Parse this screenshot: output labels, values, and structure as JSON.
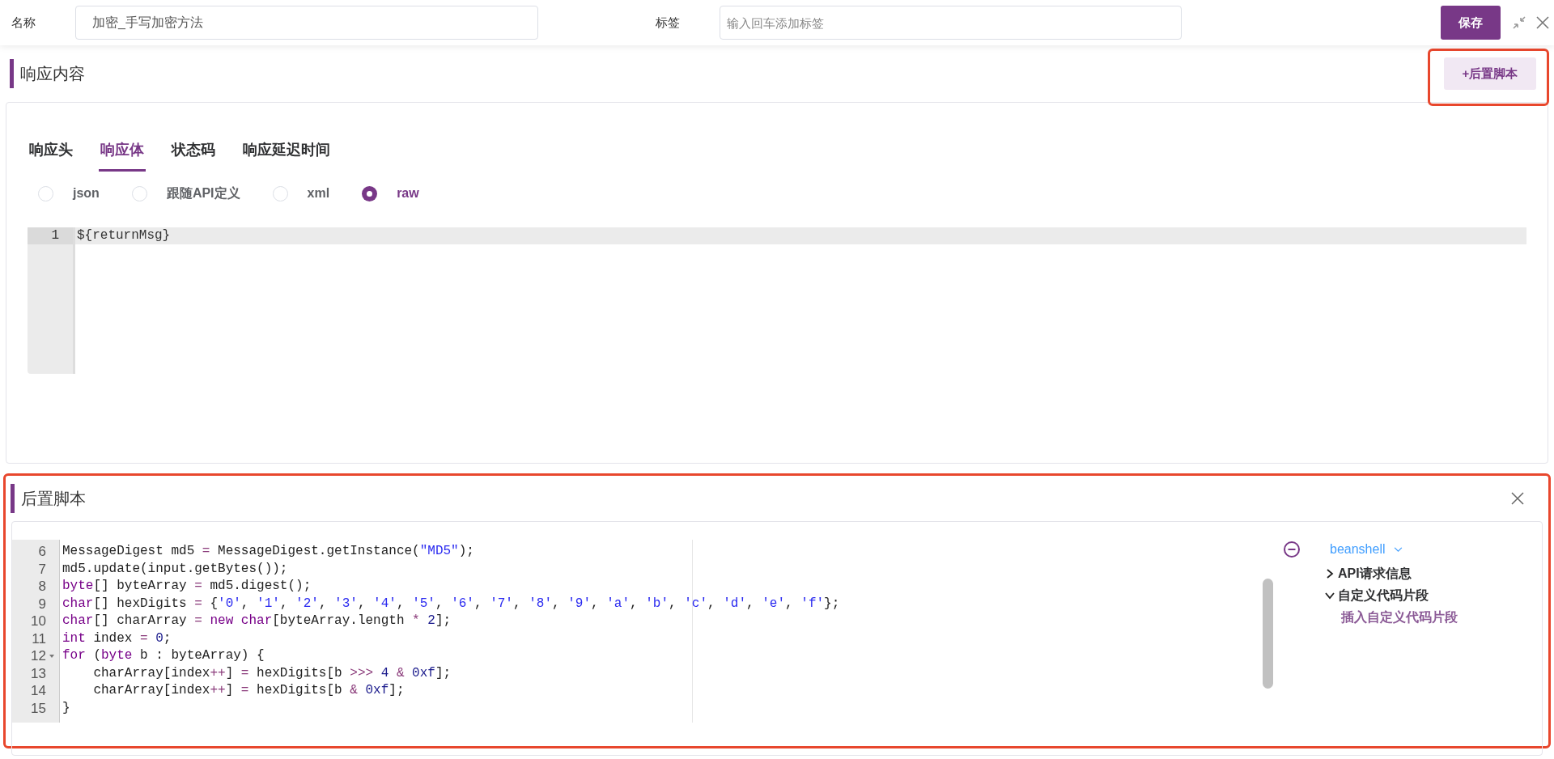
{
  "form": {
    "name_label": "名称",
    "name_value": "加密_手写加密方法",
    "tags_label": "标签",
    "tags_placeholder": "输入回车添加标签",
    "save_button": "保存"
  },
  "response_section": {
    "title": "响应内容",
    "add_script_button": "+后置脚本",
    "tabs": [
      {
        "label": "响应头",
        "selected": false
      },
      {
        "label": "响应体",
        "selected": true
      },
      {
        "label": "状态码",
        "selected": false
      },
      {
        "label": "响应延迟时间",
        "selected": false
      }
    ],
    "formats": [
      {
        "label": "json",
        "selected": false
      },
      {
        "label": "跟随API定义",
        "selected": false
      },
      {
        "label": "xml",
        "selected": false
      },
      {
        "label": "raw",
        "selected": true
      }
    ],
    "editor": {
      "lines": [
        {
          "number": "1",
          "text": "${returnMsg}"
        }
      ]
    }
  },
  "post_script": {
    "title": "后置脚本",
    "language": "beanshell",
    "lines": [
      {
        "number": "6",
        "tokens": [
          {
            "kind": "plain",
            "text": "MessageDigest md5 "
          },
          {
            "kind": "operator",
            "text": "="
          },
          {
            "kind": "plain",
            "text": " MessageDigest.getInstance("
          },
          {
            "kind": "string",
            "text": "\"MD5\""
          },
          {
            "kind": "plain",
            "text": ");"
          }
        ]
      },
      {
        "number": "7",
        "tokens": [
          {
            "kind": "plain",
            "text": "md5.update(input.getBytes());"
          }
        ]
      },
      {
        "number": "8",
        "tokens": [
          {
            "kind": "keyword",
            "text": "byte"
          },
          {
            "kind": "plain",
            "text": "[] byteArray "
          },
          {
            "kind": "operator",
            "text": "="
          },
          {
            "kind": "plain",
            "text": " md5.digest();"
          }
        ]
      },
      {
        "number": "9",
        "tokens": [
          {
            "kind": "keyword",
            "text": "char"
          },
          {
            "kind": "plain",
            "text": "[] hexDigits "
          },
          {
            "kind": "operator",
            "text": "="
          },
          {
            "kind": "plain",
            "text": " {"
          },
          {
            "kind": "string",
            "text": "'0'"
          },
          {
            "kind": "plain",
            "text": ", "
          },
          {
            "kind": "string",
            "text": "'1'"
          },
          {
            "kind": "plain",
            "text": ", "
          },
          {
            "kind": "string",
            "text": "'2'"
          },
          {
            "kind": "plain",
            "text": ", "
          },
          {
            "kind": "string",
            "text": "'3'"
          },
          {
            "kind": "plain",
            "text": ", "
          },
          {
            "kind": "string",
            "text": "'4'"
          },
          {
            "kind": "plain",
            "text": ", "
          },
          {
            "kind": "string",
            "text": "'5'"
          },
          {
            "kind": "plain",
            "text": ", "
          },
          {
            "kind": "string",
            "text": "'6'"
          },
          {
            "kind": "plain",
            "text": ", "
          },
          {
            "kind": "string",
            "text": "'7'"
          },
          {
            "kind": "plain",
            "text": ", "
          },
          {
            "kind": "string",
            "text": "'8'"
          },
          {
            "kind": "plain",
            "text": ", "
          },
          {
            "kind": "string",
            "text": "'9'"
          },
          {
            "kind": "plain",
            "text": ", "
          },
          {
            "kind": "string",
            "text": "'a'"
          },
          {
            "kind": "plain",
            "text": ", "
          },
          {
            "kind": "string",
            "text": "'b'"
          },
          {
            "kind": "plain",
            "text": ", "
          },
          {
            "kind": "string",
            "text": "'c'"
          },
          {
            "kind": "plain",
            "text": ", "
          },
          {
            "kind": "string",
            "text": "'d'"
          },
          {
            "kind": "plain",
            "text": ", "
          },
          {
            "kind": "string",
            "text": "'e'"
          },
          {
            "kind": "plain",
            "text": ", "
          },
          {
            "kind": "string",
            "text": "'f'"
          },
          {
            "kind": "plain",
            "text": "};"
          }
        ]
      },
      {
        "number": "10",
        "tokens": [
          {
            "kind": "keyword",
            "text": "char"
          },
          {
            "kind": "plain",
            "text": "[] charArray "
          },
          {
            "kind": "operator",
            "text": "="
          },
          {
            "kind": "keyword",
            "text": " new"
          },
          {
            "kind": "keyword",
            "text": " char"
          },
          {
            "kind": "plain",
            "text": "[byteArray.length "
          },
          {
            "kind": "operator",
            "text": "*"
          },
          {
            "kind": "number",
            "text": " 2"
          },
          {
            "kind": "plain",
            "text": "];"
          }
        ]
      },
      {
        "number": "11",
        "tokens": [
          {
            "kind": "keyword",
            "text": "int"
          },
          {
            "kind": "plain",
            "text": " index "
          },
          {
            "kind": "operator",
            "text": "="
          },
          {
            "kind": "number",
            "text": " 0"
          },
          {
            "kind": "plain",
            "text": ";"
          }
        ]
      },
      {
        "number": "12",
        "foldable": true,
        "tokens": [
          {
            "kind": "keyword",
            "text": "for"
          },
          {
            "kind": "plain",
            "text": " ("
          },
          {
            "kind": "keyword",
            "text": "byte"
          },
          {
            "kind": "plain",
            "text": " b : byteArray) {"
          }
        ]
      },
      {
        "number": "13",
        "tokens": [
          {
            "kind": "plain",
            "text": "    charArray[index"
          },
          {
            "kind": "operator",
            "text": "++"
          },
          {
            "kind": "plain",
            "text": "] "
          },
          {
            "kind": "operator",
            "text": "="
          },
          {
            "kind": "plain",
            "text": " hexDigits[b "
          },
          {
            "kind": "operator",
            "text": ">>>"
          },
          {
            "kind": "number",
            "text": " 4"
          },
          {
            "kind": "operator",
            "text": " &"
          },
          {
            "kind": "number",
            "text": " 0xf"
          },
          {
            "kind": "plain",
            "text": "];"
          }
        ]
      },
      {
        "number": "14",
        "tokens": [
          {
            "kind": "plain",
            "text": "    charArray[index"
          },
          {
            "kind": "operator",
            "text": "++"
          },
          {
            "kind": "plain",
            "text": "] "
          },
          {
            "kind": "operator",
            "text": "="
          },
          {
            "kind": "plain",
            "text": " hexDigits[b "
          },
          {
            "kind": "operator",
            "text": "&"
          },
          {
            "kind": "number",
            "text": " 0xf"
          },
          {
            "kind": "plain",
            "text": "];"
          }
        ]
      },
      {
        "number": "15",
        "tokens": [
          {
            "kind": "plain",
            "text": "}"
          }
        ]
      }
    ],
    "tree": [
      {
        "label": "API请求信息",
        "expanded": false
      },
      {
        "label": "自定义代码片段",
        "expanded": true,
        "children": [
          {
            "label": "插入自定义代码片段"
          }
        ]
      }
    ]
  }
}
